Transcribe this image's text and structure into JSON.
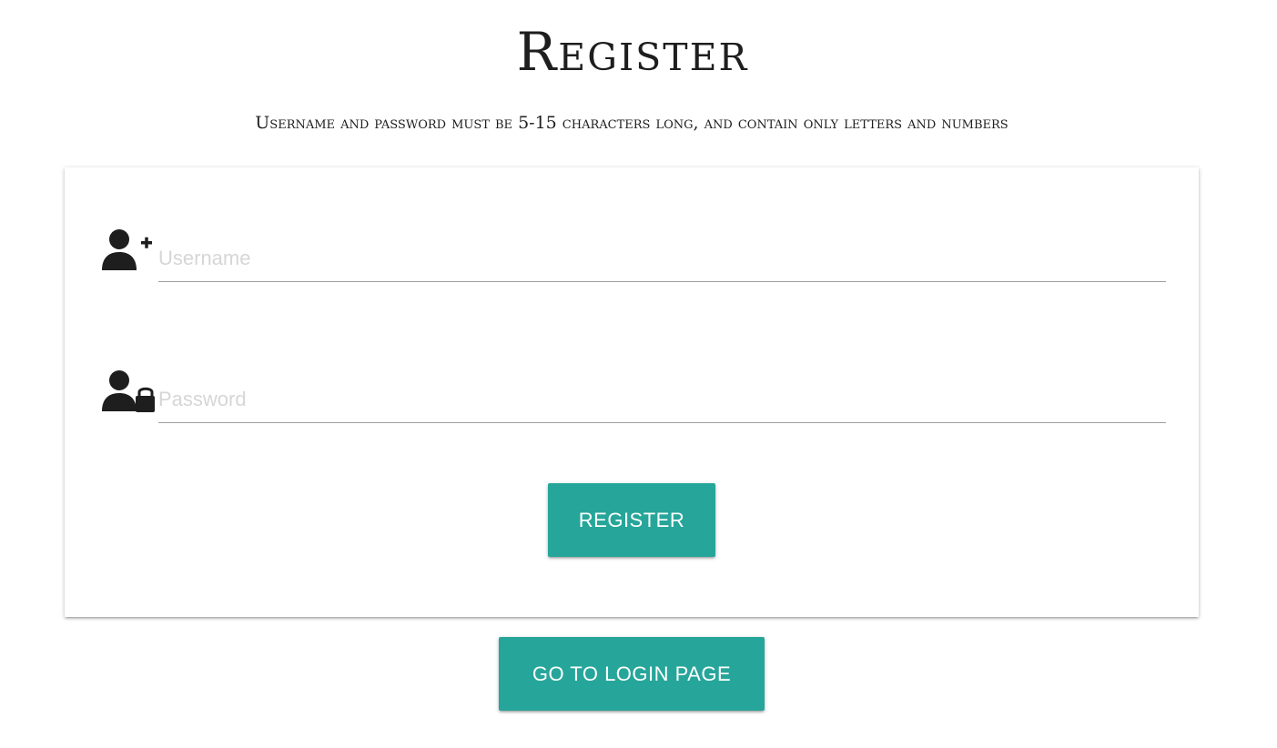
{
  "page": {
    "title": "Register",
    "subtitle": "Username and password must be 5-15 characters long, and contain only letters and numbers"
  },
  "form": {
    "username": {
      "icon": "person-add-icon",
      "placeholder": "Username",
      "value": ""
    },
    "password": {
      "icon": "person-lock-icon",
      "placeholder": "Password",
      "value": ""
    },
    "register_label": "Register"
  },
  "footer": {
    "login_label": "Go to login page"
  },
  "colors": {
    "accent": "#26a69a",
    "text": "#1e1e1e",
    "placeholder": "#d6d6d6",
    "underline": "#9e9e9e"
  }
}
